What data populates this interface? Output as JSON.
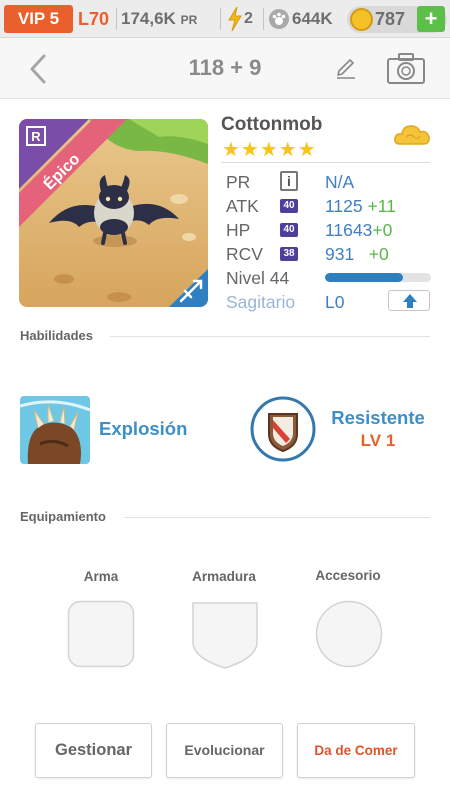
{
  "status_bar": {
    "vip": "VIP 5",
    "level": "L70",
    "power": "174,6K",
    "power_unit": "PR",
    "energy": "2",
    "food": "644K",
    "coins": "787",
    "add_label": "+"
  },
  "header": {
    "count": "118 + 9"
  },
  "monster": {
    "name": "Cottonmob",
    "rarity": "Épico",
    "rank_letter": "R",
    "stars": "★★★★★",
    "star_count": 5,
    "stats": {
      "pr_label": "PR",
      "pr_info": "i",
      "pr_value": "N/A",
      "atk_label": "ATK",
      "atk_badge": "40",
      "atk_value": "1125",
      "atk_bonus": "+11",
      "hp_label": "HP",
      "hp_badge": "40",
      "hp_value": "11643",
      "hp_bonus": "+0",
      "rcv_label": "RCV",
      "rcv_badge": "38",
      "rcv_value": "931",
      "rcv_bonus": "+0"
    },
    "level_label": "Nivel 44",
    "level_progress": 0.74,
    "sign": "Sagitario",
    "sign_level": "L0"
  },
  "abilities": {
    "title": "Habilidades",
    "skill_1": "Explosión",
    "skill_2": "Resistente",
    "skill_2_level": "LV 1"
  },
  "equipment": {
    "title": "Equipamiento",
    "weapon": "Arma",
    "armor": "Armadura",
    "accessory": "Accesorio"
  },
  "actions": {
    "manage": "Gestionar",
    "evolve": "Evolucionar",
    "feed": "Da de Comer"
  },
  "colors": {
    "accent_orange": "#e9602c",
    "accent_blue": "#3e8ec8",
    "bonus_green": "#57b845",
    "star_yellow": "#f7c514"
  }
}
